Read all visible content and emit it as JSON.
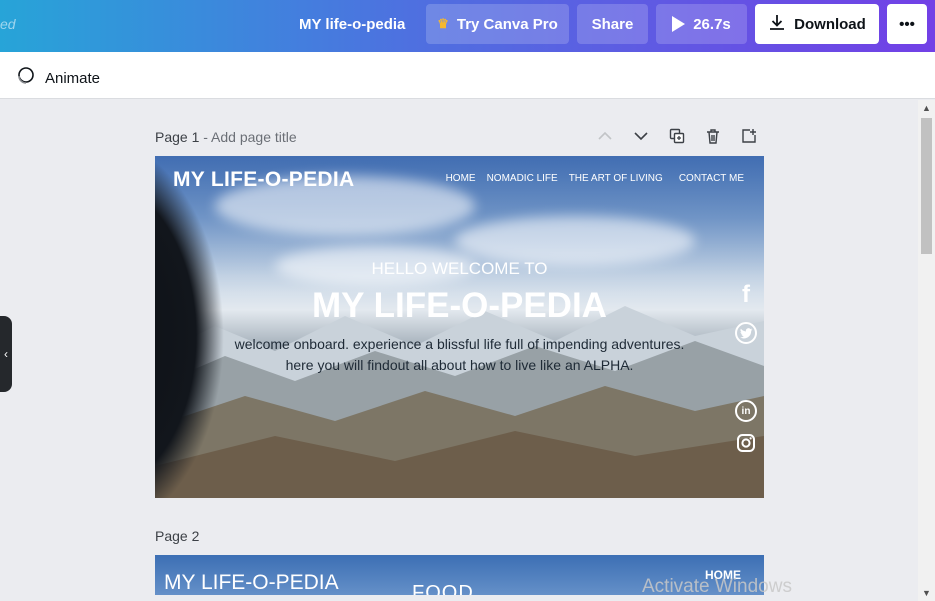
{
  "topbar": {
    "saved_fragment": "ed",
    "doc_title": "MY life-o-pedia",
    "try_pro_label": "Try Canva Pro",
    "share_label": "Share",
    "play_duration": "26.7s",
    "download_label": "Download",
    "more_label": "•••",
    "colors": {
      "gradient_start": "#27a4d8",
      "gradient_end": "#7240e6",
      "crown": "#f5b82e"
    }
  },
  "subbar": {
    "animate_label": "Animate"
  },
  "page1": {
    "label": "Page 1",
    "title_placeholder": "- Add page title",
    "tools": [
      "chevron-up-icon",
      "chevron-down-icon",
      "duplicate-icon",
      "trash-icon",
      "add-page-icon"
    ],
    "design": {
      "brand": "MY LIFE-O-PEDIA",
      "nav": [
        "HOME",
        "NOMADIC LIFE",
        "THE ART OF LIVING",
        "CONTACT ME"
      ],
      "hello": "HELLO WELCOME TO",
      "title": "MY LIFE-O-PEDIA",
      "desc_line1": "welcome onboard. experience a blissful life full of impending adventures.",
      "desc_line2": "here you will findout all about how to live like an ALPHA.",
      "social": [
        "facebook-icon",
        "twitter-icon",
        "linkedin-icon",
        "instagram-icon"
      ]
    }
  },
  "page2": {
    "label": "Page 2",
    "design": {
      "brand": "MY LIFE-O-PEDIA",
      "food": "FOOD",
      "home": "HOME"
    }
  },
  "watermark": "Activate Windows"
}
